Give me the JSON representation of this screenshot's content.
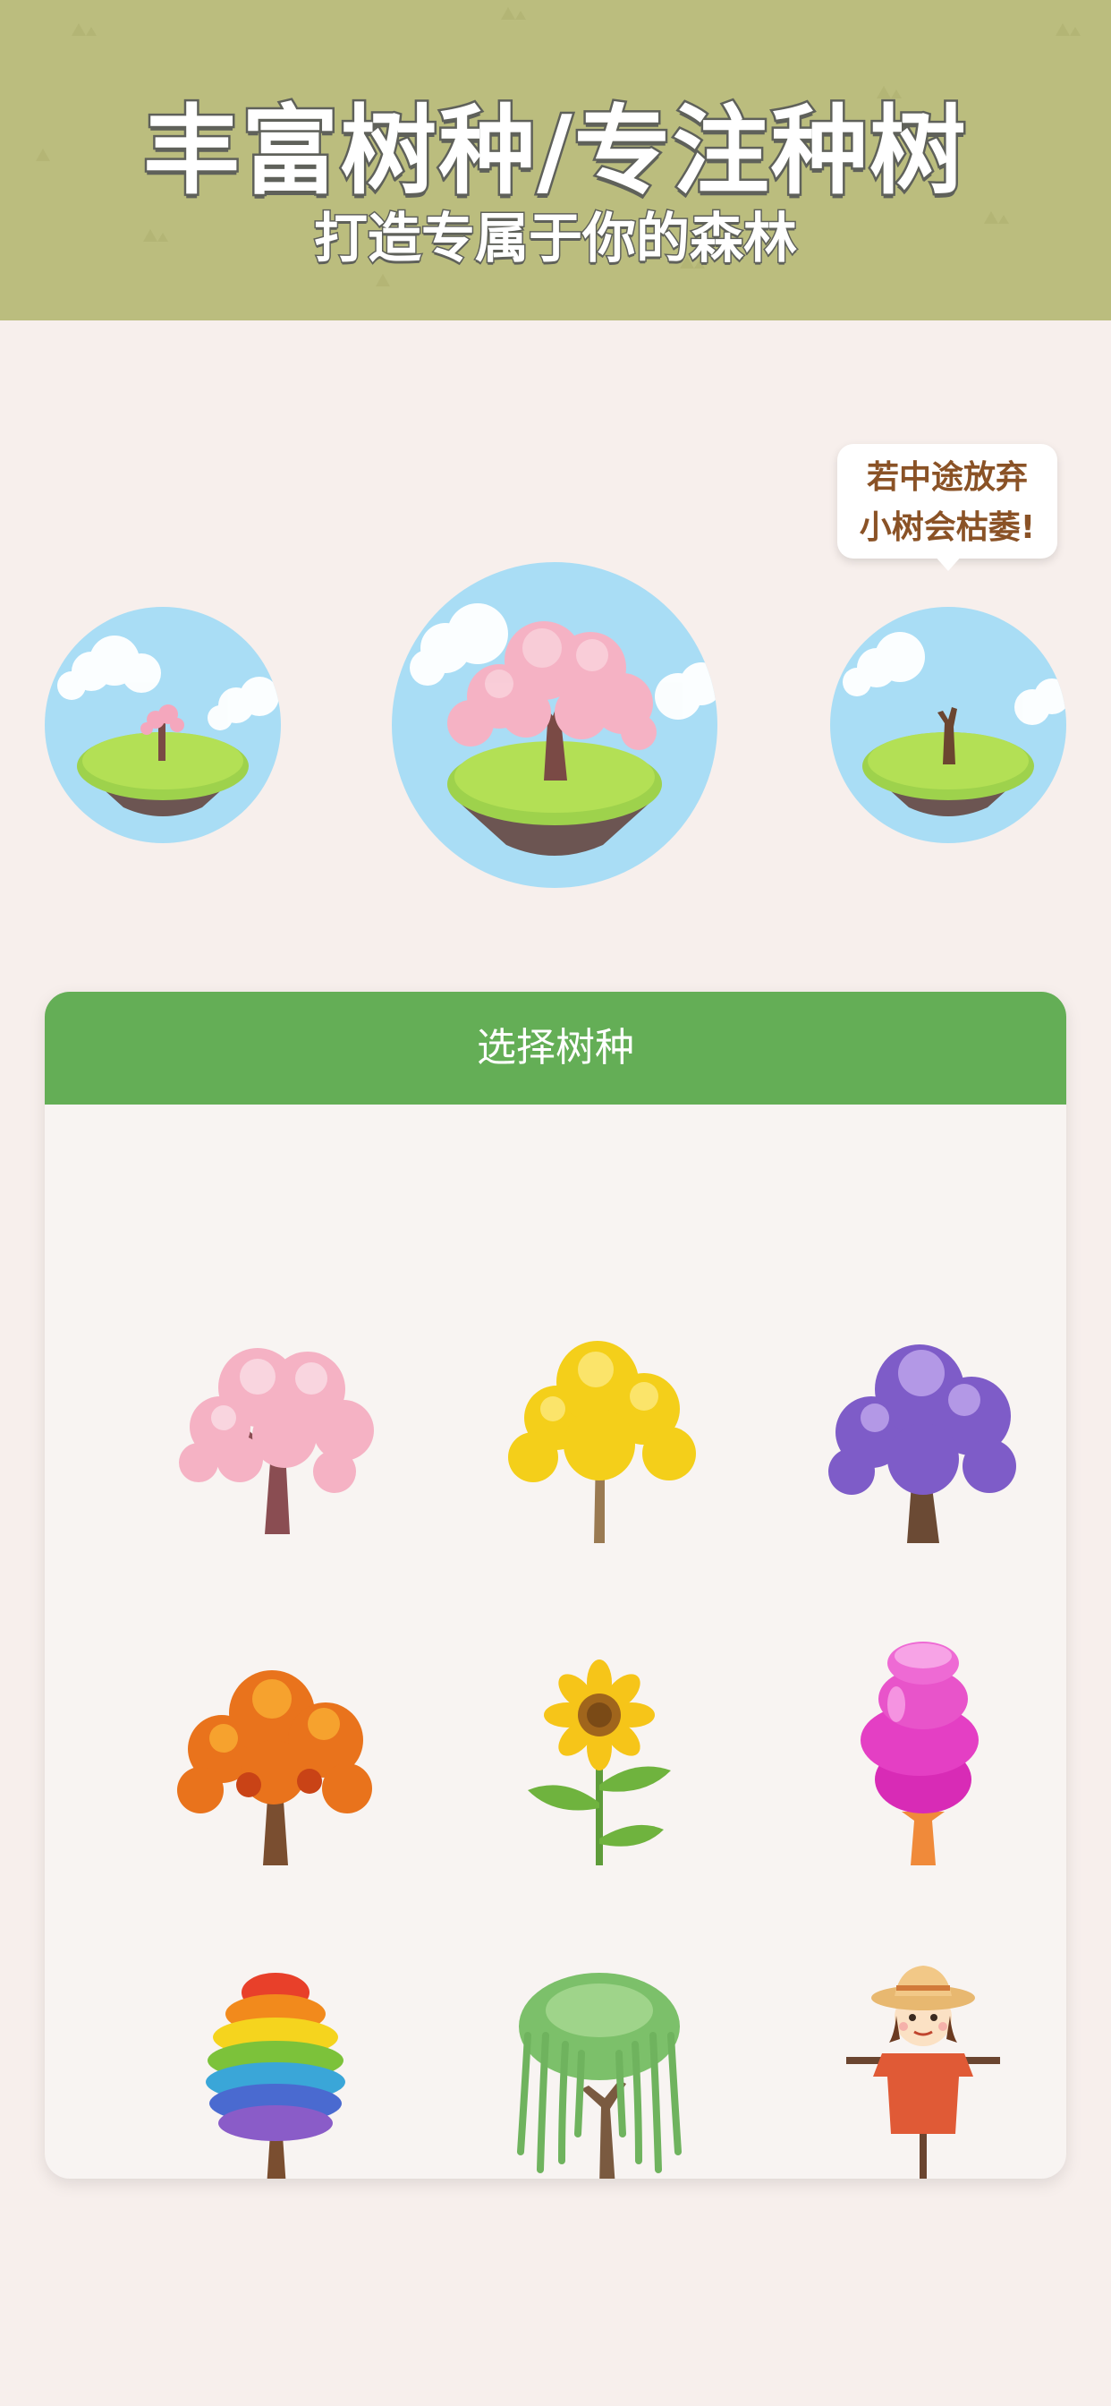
{
  "header": {
    "title": "丰富树种/专注种树",
    "subtitle": "打造专属于你的森林"
  },
  "planets": [
    {
      "name": "sapling-stage",
      "tree": "small-cherry"
    },
    {
      "name": "grown-stage",
      "tree": "cherry-blossom"
    },
    {
      "name": "withered-stage",
      "tree": "dead-tree"
    }
  ],
  "bubble": {
    "line1": "若中途放弃",
    "line2": "小树会枯萎!"
  },
  "tree_picker": {
    "title": "选择树种",
    "species_icons": [
      "cherry-blossom-tree-icon",
      "golden-ginkgo-tree-icon",
      "purple-tree-icon",
      "autumn-maple-tree-icon",
      "sunflower-icon",
      "pink-candy-tree-icon",
      "rainbow-tree-icon",
      "willow-tree-icon",
      "scarecrow-icon"
    ]
  },
  "colors": {
    "banner": "#bbbd7e",
    "background": "#f7efec",
    "card_header": "#64ae56",
    "bubble_text": "#8a5226",
    "sky": "#a9ddf5",
    "grass": "#9ed24c"
  }
}
